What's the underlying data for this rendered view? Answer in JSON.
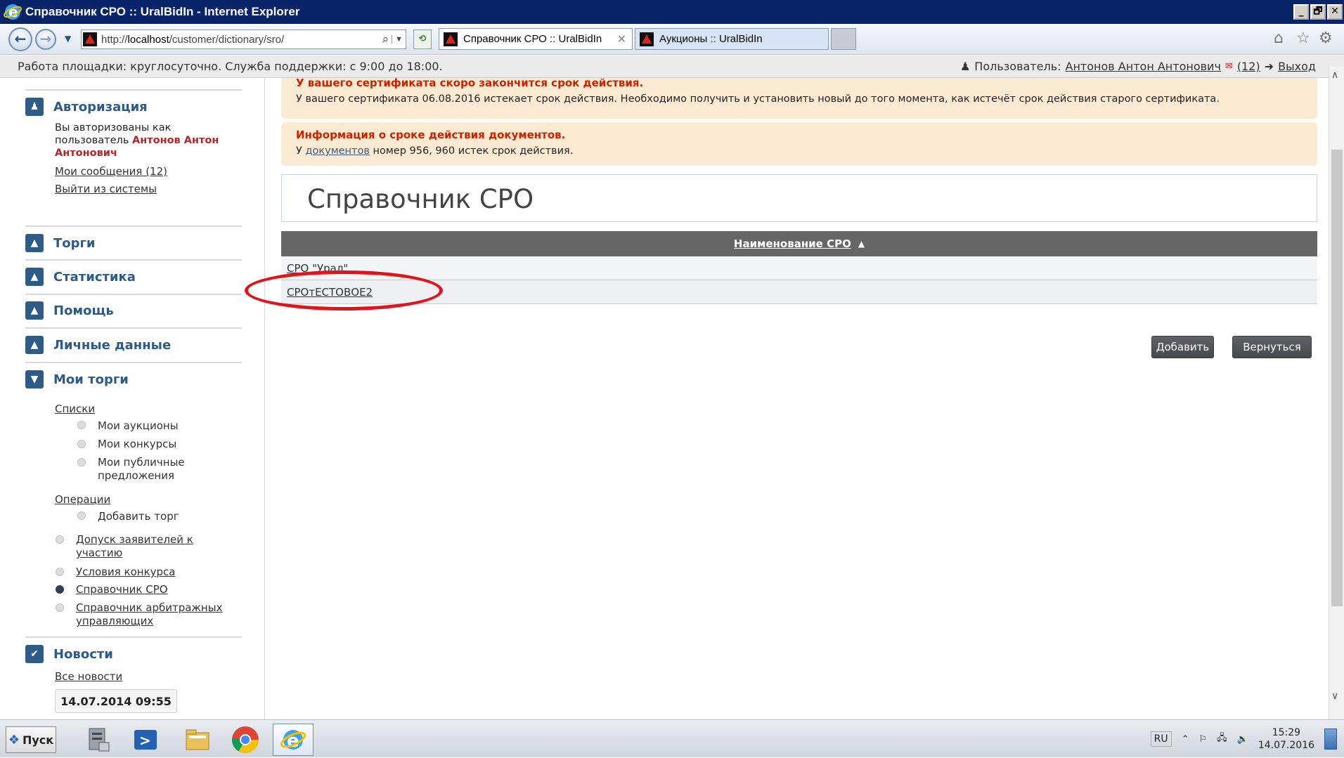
{
  "window": {
    "title": "Справочник СРО :: UralBidIn - Internet Explorer",
    "controls": [
      "_",
      "🗗",
      "✕"
    ]
  },
  "browser": {
    "url_prefix": "http://",
    "url_host": "localhost",
    "url_path": "/customer/dictionary/sro/",
    "tabs": [
      {
        "label": "Справочник СРО :: UralBidIn",
        "active": true
      },
      {
        "label": "Аукционы :: UralBidIn",
        "active": false
      }
    ]
  },
  "infostrip": {
    "work_hours": "Работа площадки: круглосуточно. Служба поддержки: с 9:00 до 18:00.",
    "user_label": "Пользователь:",
    "user_name": "Антонов Антон Антонович",
    "messages": "(12)",
    "logout": "Выход"
  },
  "sidebar": {
    "auth": {
      "title": "Авторизация",
      "line1": "Вы авторизованы как",
      "line2_prefix": "пользователь",
      "user_part1": "Антонов Антон",
      "user_part2": "Антонович",
      "messages_link": "Мои сообщения (12)",
      "logout_link": "Выйти из системы"
    },
    "sections": [
      "Торги",
      "Статистика",
      "Помощь",
      "Личные данные",
      "Мои торги"
    ],
    "my_trades": {
      "lists_label": "Списки",
      "lists": [
        "Мои аукционы",
        "Мои конкурсы",
        "Мои публичные",
        "предложения"
      ],
      "operations_label": "Операции",
      "operations": [
        "Добавить торг"
      ],
      "links": [
        "Допуск заявителей к",
        "участию",
        "Условия конкурса",
        "Справочник СРО",
        "Справочник арбитражных",
        "управляющих"
      ]
    },
    "news": {
      "title": "Новости",
      "all_link": "Все новости",
      "date": "14.07.2014 09:55"
    }
  },
  "main": {
    "alert1": {
      "title": "У вашего сертификата скоро закончится срок действия.",
      "text": "У вашего сертификата 06.08.2016 истекает срок действия. Необходимо получить и установить новый до того момента, как истечёт срок действия старого сертификата."
    },
    "alert2": {
      "title": "Информация о сроке действия документов.",
      "text_prefix": "У",
      "link": "документов",
      "text_suffix": "номер 956, 960 истек срок действия."
    },
    "page_title": "Справочник СРО",
    "table": {
      "header": "Наименование СРО",
      "sort_indicator": "▲",
      "rows": [
        "СРО \"Урал\"",
        "СРОтЕСТОВОЕ2"
      ]
    },
    "buttons": {
      "add": "Добавить",
      "back": "Вернуться"
    }
  },
  "taskbar": {
    "start": "Пуск",
    "lang": "RU",
    "time": "15:29",
    "date": "14.07.2016"
  },
  "colors": {
    "accent": "#2d5b88",
    "alert_bg": "#fcebd2",
    "alert_title": "#cc2200",
    "highlight": "#e0141c"
  }
}
